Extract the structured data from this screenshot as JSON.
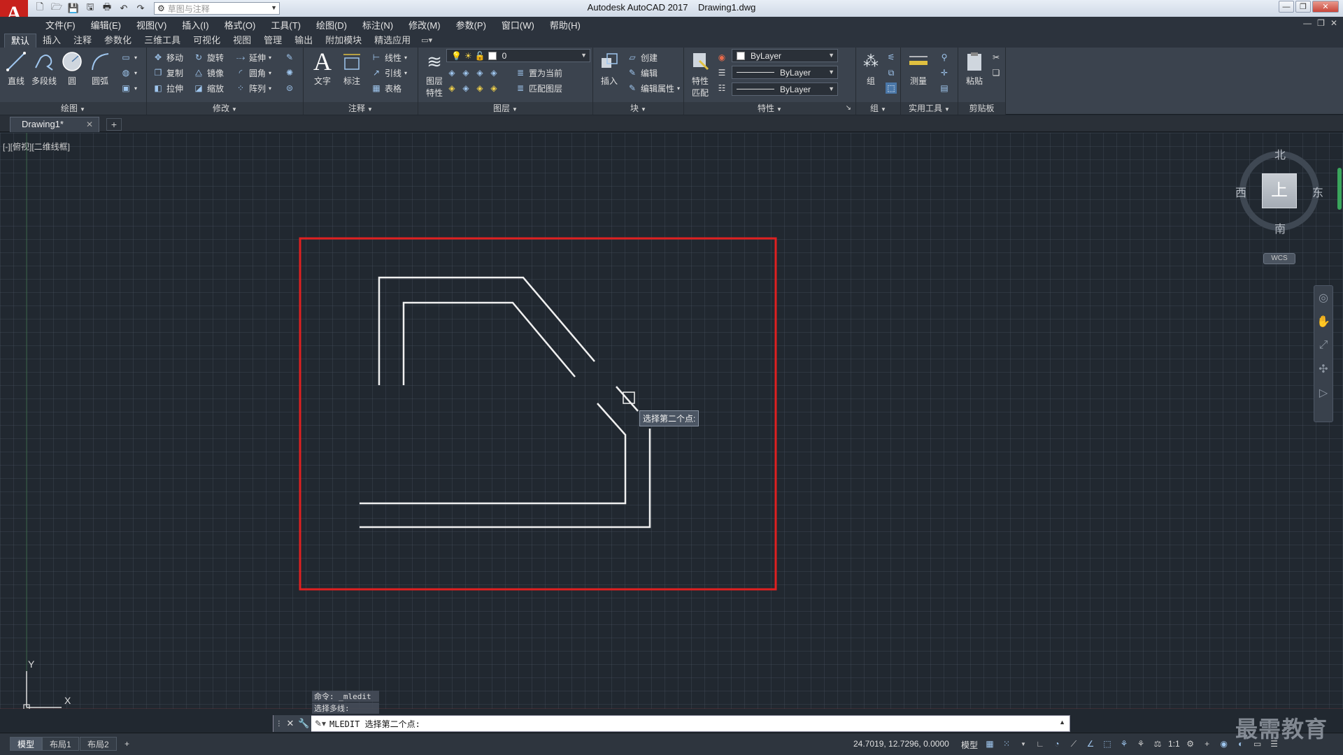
{
  "titlebar": {
    "app_title": "Autodesk AutoCAD 2017",
    "file_name": "Drawing1.dwg",
    "workspace": "草图与注释",
    "logo_letter": "A"
  },
  "menu": [
    "文件(F)",
    "编辑(E)",
    "视图(V)",
    "插入(I)",
    "格式(O)",
    "工具(T)",
    "绘图(D)",
    "标注(N)",
    "修改(M)",
    "参数(P)",
    "窗口(W)",
    "帮助(H)"
  ],
  "ribbon_tabs": [
    "默认",
    "插入",
    "注释",
    "参数化",
    "三维工具",
    "可视化",
    "视图",
    "管理",
    "输出",
    "附加模块",
    "精选应用"
  ],
  "ribbon": {
    "draw": {
      "title": "绘图",
      "line": "直线",
      "polyline": "多段线",
      "circle": "圆",
      "arc": "圆弧"
    },
    "modify": {
      "title": "修改",
      "move": "移动",
      "rotate": "旋转",
      "trim": "延伸",
      "copy": "复制",
      "mirror": "镜像",
      "fillet": "圆角",
      "stretch": "拉伸",
      "scale": "缩放",
      "array": "阵列"
    },
    "annotation": {
      "title": "注释",
      "text": "文字",
      "dimension": "标注",
      "linear": "线性",
      "leader": "引线",
      "table": "表格"
    },
    "layers": {
      "title": "图层",
      "layer_props": "图层\n特性",
      "layer_props_1": "图层",
      "layer_props_2": "特性",
      "current_layer": "0",
      "make_current": "置为当前",
      "match_layer": "匹配图层"
    },
    "block": {
      "title": "块",
      "insert": "插入",
      "create": "创建",
      "edit": "编辑",
      "edit_attr": "编辑属性"
    },
    "properties": {
      "title": "特性",
      "match_1": "特性",
      "match_2": "匹配",
      "color": "ByLayer",
      "linetype": "ByLayer",
      "lineweight": "ByLayer"
    },
    "groups": {
      "title": "组",
      "group": "组"
    },
    "utilities": {
      "title": "实用工具",
      "measure": "测量"
    },
    "clipboard": {
      "title": "剪贴板",
      "paste": "粘贴"
    }
  },
  "doc_tab": {
    "name": "Drawing1*"
  },
  "viewport": {
    "label": "[-][俯视][二维线框]",
    "tooltip": "选择第二个点:",
    "ucs_x": "X",
    "ucs_y": "Y"
  },
  "viewcube": {
    "north": "北",
    "south": "南",
    "east": "东",
    "west": "西",
    "face": "上",
    "wcs": "WCS"
  },
  "command": {
    "history": [
      "命令: _mledit",
      "选择多线:"
    ],
    "current": "MLEDIT 选择第二个点:"
  },
  "status": {
    "layouts": [
      "模型",
      "布局1",
      "布局2"
    ],
    "coords": "24.7019, 12.7296, 0.0000",
    "space": "模型",
    "scale": "1:1"
  },
  "watermark": "最需教育",
  "colors": {
    "background": "#212830",
    "highlight_box": "#e02020",
    "lines": "#f0f0f0",
    "brand": "#c7211c"
  }
}
